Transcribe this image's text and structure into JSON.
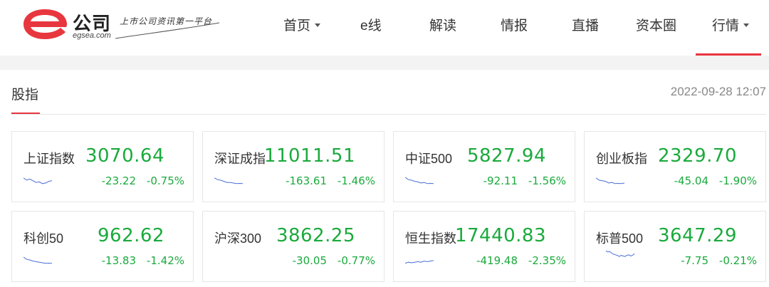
{
  "header": {
    "logo": {
      "mark": "e",
      "brand_cn": "公司",
      "brand_en": "egsea.com",
      "slogan": "上市公司资讯第一平台"
    },
    "nav": [
      {
        "label": "首页",
        "dropdown": true,
        "active": false
      },
      {
        "label": "e线",
        "dropdown": false,
        "active": false
      },
      {
        "label": "解读",
        "dropdown": false,
        "active": false
      },
      {
        "label": "情报",
        "dropdown": false,
        "active": false
      },
      {
        "label": "直播",
        "dropdown": false,
        "active": false
      },
      {
        "label": "资本圈",
        "dropdown": false,
        "active": false
      },
      {
        "label": "行情",
        "dropdown": true,
        "active": true
      }
    ]
  },
  "section": {
    "title": "股指",
    "timestamp": "2022-09-28 12:07"
  },
  "colors": {
    "accent": "#e8363f",
    "down_green": "#1aaa3c",
    "spark_blue": "#4a6fd6"
  },
  "indices": [
    {
      "name": "上证指数",
      "value": "3070.64",
      "change": "-23.22",
      "pct": "-0.75%",
      "trend": [
        0.3,
        0.5,
        0.4,
        0.55,
        0.7,
        0.65,
        0.8,
        0.75,
        0.6,
        0.55
      ]
    },
    {
      "name": "深证成指",
      "value": "11011.51",
      "change": "-163.61",
      "pct": "-1.46%",
      "trend": [
        0.3,
        0.45,
        0.5,
        0.6,
        0.7,
        0.7,
        0.75,
        0.8,
        0.78,
        0.8
      ]
    },
    {
      "name": "中证500",
      "value": "5827.94",
      "change": "-92.11",
      "pct": "-1.56%",
      "trend": [
        0.25,
        0.45,
        0.5,
        0.6,
        0.65,
        0.75,
        0.7,
        0.8,
        0.78,
        0.8
      ]
    },
    {
      "name": "创业板指",
      "value": "2329.70",
      "change": "-45.04",
      "pct": "-1.90%",
      "trend": [
        0.3,
        0.5,
        0.55,
        0.6,
        0.75,
        0.7,
        0.8,
        0.78,
        0.8,
        0.75
      ]
    },
    {
      "name": "科创50",
      "value": "962.62",
      "change": "-13.83",
      "pct": "-1.42%",
      "trend": [
        0.25,
        0.45,
        0.5,
        0.6,
        0.65,
        0.7,
        0.75,
        0.8,
        0.78,
        0.8
      ]
    },
    {
      "name": "沪深300",
      "value": "3862.25",
      "change": "-30.05",
      "pct": "-0.77%",
      "trend": []
    },
    {
      "name": "恒生指数",
      "value": "17440.83",
      "change": "-419.48",
      "pct": "-2.35%",
      "trend": [
        0.8,
        0.7,
        0.75,
        0.7,
        0.65,
        0.7,
        0.6,
        0.65,
        0.6,
        0.55
      ]
    },
    {
      "name": "标普500",
      "value": "3647.29",
      "change": "-7.75",
      "pct": "-0.21%",
      "trend": [
        0.2,
        0.3,
        0.25,
        0.4,
        0.5,
        0.55,
        0.6,
        0.7,
        0.6,
        0.65,
        0.7,
        0.6,
        0.55,
        0.65,
        0.6,
        0.45
      ]
    }
  ]
}
